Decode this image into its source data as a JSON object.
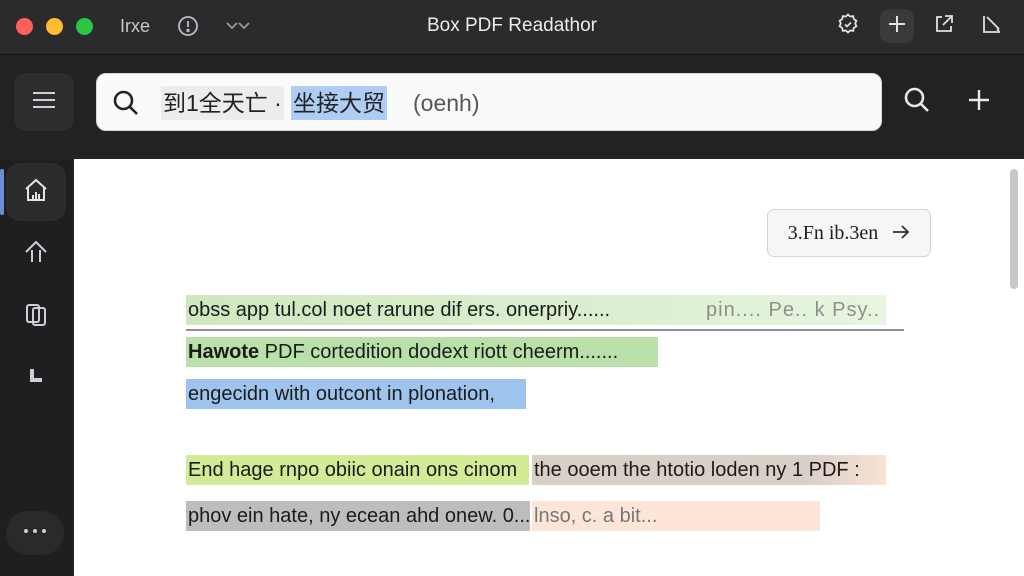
{
  "app": {
    "title": "Box PDF Readathor",
    "tab_label": "Irxe"
  },
  "search": {
    "query_part1": "到1全天亡 ·",
    "query_part2": "坐接大贸",
    "query_part3": "(oenh)"
  },
  "document": {
    "page_chip_label": "3.Fn ib.3en",
    "lines": {
      "line1": "obss app tul.col noet rarune dif ers. onerpriy......",
      "line1_faint": "pin.... Pe.. k Psy..  -",
      "line2_bold": "Hawote",
      "line2_rest": " PDF cortedition dodext riott cheerm.......",
      "line3": "engecidn with outcont in plonation,",
      "line4": "End hage rnpo obiic onain ons cinom",
      "line5": "the ooem the htotio loden ny 1 PDF :",
      "line6": "phov ein hate, ny ecean ahd onew. 0....",
      "line7": "lnso, c. a bit..."
    }
  },
  "colors": {
    "accent": "#6a8fd6",
    "highlight_green": "#b8e0a8",
    "highlight_blue": "#9ec3ec",
    "highlight_lime": "#d2eb96",
    "highlight_gray": "#bdbdbd",
    "highlight_peach": "#fde6d8"
  },
  "icons": {
    "tab_menu": "chevron-down-icon",
    "hint": "lightbulb-icon",
    "titlebar_buttons": [
      "settings-icon",
      "plus-icon",
      "share-icon",
      "annotate-icon"
    ],
    "toolbar": [
      "menu-icon",
      "search-icon",
      "plus-icon"
    ],
    "sidebar": [
      "home-icon",
      "up-arrow-icon",
      "pages-icon",
      "bookmark-icon",
      "more-icon"
    ]
  }
}
